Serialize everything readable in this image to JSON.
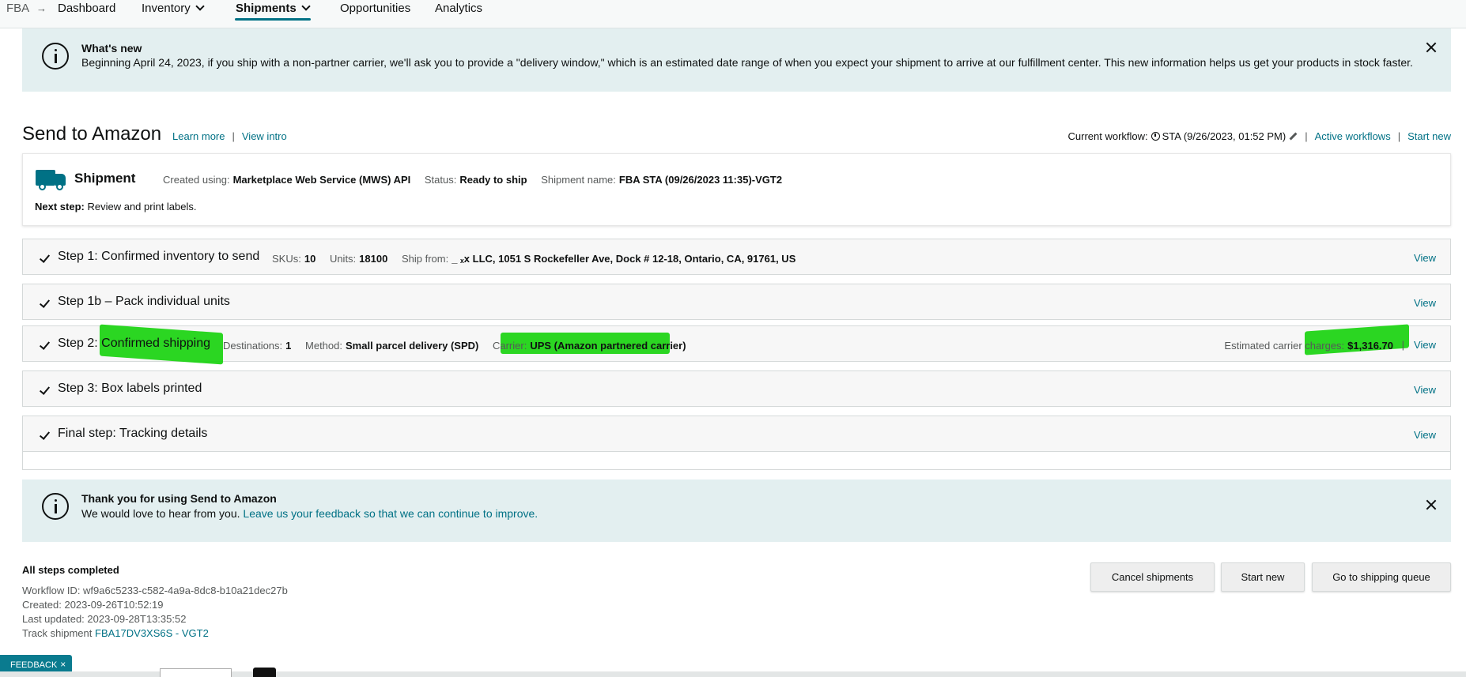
{
  "nav": {
    "fba": "FBA",
    "arrow": "→",
    "items": [
      "Dashboard",
      "Inventory",
      "Shipments",
      "Opportunities",
      "Analytics"
    ]
  },
  "whats_new": {
    "title": "What's new",
    "text": "Beginning April 24, 2023, if you ship with a non-partner carrier, we'll ask you to provide a \"delivery window,\" which is an estimated date range of when you expect your shipment to arrive at our fulfillment center. This new information helps us get your products in stock faster."
  },
  "page": {
    "title": "Send to Amazon",
    "learn_more": "Learn more",
    "view_intro": "View intro",
    "sep": "|"
  },
  "workflow": {
    "label": "Current workflow:",
    "current": "STA (9/26/2023, 01:52 PM)",
    "active": "Active workflows",
    "start_new": "Start new"
  },
  "shipment": {
    "title": "Shipment",
    "created_label": "Created using:",
    "created_value": "Marketplace Web Service (MWS) API",
    "status_label": "Status:",
    "status_value": "Ready to ship",
    "name_label": "Shipment name:",
    "name_value": "FBA STA (09/26/2023 11:35)-VGT2",
    "next_label": "Next step:",
    "next_value": "Review and print labels."
  },
  "steps": [
    {
      "title": "Step 1: Confirmed inventory to send",
      "skus_label": "SKUs:",
      "skus": "10",
      "units_label": "Units:",
      "units": "18100",
      "ship_from_label": "Ship from:",
      "ship_from": "_        ₓx LLC, 1051 S Rockefeller Ave, Dock # 12-18, Ontario, CA, 91761, US",
      "view": "View"
    },
    {
      "title": "Step 1b – Pack individual units",
      "view": "View"
    },
    {
      "title": "Step 2: Confirmed shipping",
      "dest_label": "Destinations:",
      "dest": "1",
      "method_label": "Method:",
      "method": "Small parcel delivery (SPD)",
      "carrier_label": "Carrier:",
      "carrier": "UPS (Amazon partnered carrier)",
      "charges_label": "Estimated carrier charges:",
      "charges": "$1,316.70",
      "view": "View"
    },
    {
      "title": "Step 3: Box labels printed",
      "view": "View"
    },
    {
      "title": "Final step: Tracking details",
      "view": "View"
    }
  ],
  "thanks": {
    "title": "Thank you for using Send to Amazon",
    "text": "We would love to hear from you.",
    "link": "Leave us your feedback so that we can continue to improve."
  },
  "summary": {
    "title": "All steps completed",
    "workflow_id": "Workflow ID: wf9a6c5233-c582-4a9a-8dc8-b10a21dec27b",
    "created": "Created: 2023-09-26T10:52:19",
    "updated": "Last updated: 2023-09-28T13:35:52",
    "track_label": "Track shipment",
    "track_link": "FBA17DV3XS6S - VGT2"
  },
  "buttons": {
    "cancel": "Cancel shipments",
    "start_new": "Start new",
    "queue": "Go to shipping queue"
  },
  "feedback": {
    "label": "FEEDBACK",
    "close": "×"
  },
  "colors": {
    "accent": "#007185",
    "banner": "#e3eff0",
    "highlight": "#19d20f"
  }
}
